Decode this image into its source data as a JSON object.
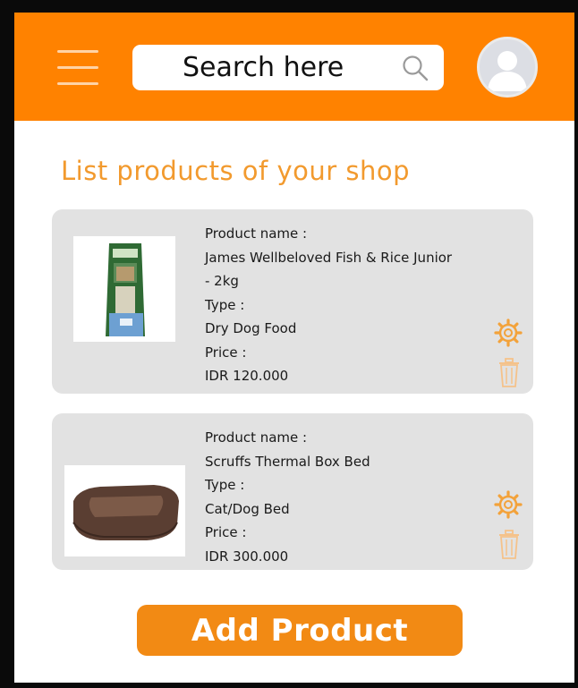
{
  "header": {
    "menu_icon": "hamburger-menu-icon",
    "search": {
      "placeholder": "Search here",
      "icon": "search-icon"
    },
    "avatar_icon": "user-avatar-icon",
    "bg_color": "#ff8200"
  },
  "main": {
    "title": "List products of your shop",
    "products": [
      {
        "name_label": "Product name :",
        "name_line1": "James Wellbeloved Fish & Rice Junior",
        "name_line2": "- 2kg",
        "type_label": "Type :",
        "type": "Dry Dog Food",
        "price_label": "Price :",
        "price": "IDR 120.000",
        "image": "dog-food-bag-image",
        "edit_icon": "gear-icon",
        "delete_icon": "trash-icon"
      },
      {
        "name_label": "Product name :",
        "name_line1": "Scruffs Thermal Box Bed",
        "type_label": "Type :",
        "type": "Cat/Dog Bed",
        "price_label": "Price :",
        "price": "IDR 300.000",
        "image": "pet-bed-image",
        "edit_icon": "gear-icon",
        "delete_icon": "trash-icon"
      }
    ],
    "add_button": "Add Product"
  },
  "colors": {
    "accent": "#ff8200",
    "title": "#f29a2e",
    "card": "#e2e2e2",
    "button": "#f28a14"
  }
}
